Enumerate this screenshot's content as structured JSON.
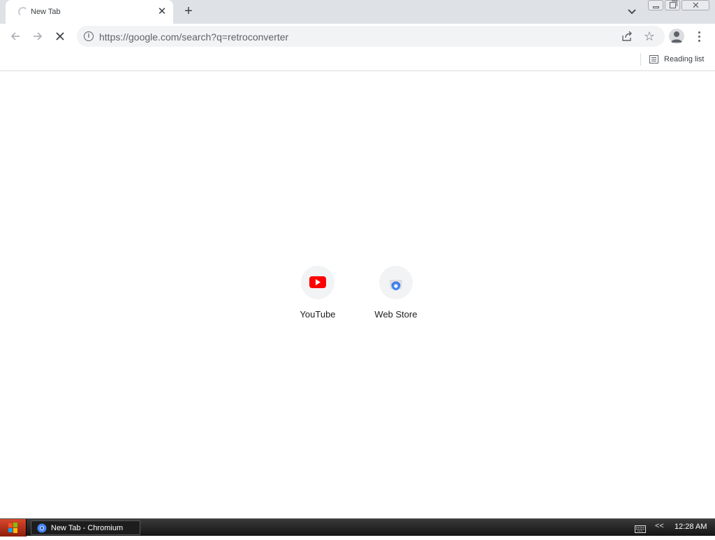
{
  "tab": {
    "title": "New Tab",
    "close_symbol": "✕",
    "new_tab_symbol": "+"
  },
  "omnibox": {
    "url": "https://google.com/search?q=retroconverter"
  },
  "bookmarks_bar": {
    "reading_list_label": "Reading list"
  },
  "shortcuts": [
    {
      "label": "YouTube",
      "icon": "youtube-icon"
    },
    {
      "label": "Web Store",
      "icon": "web-store-icon"
    }
  ],
  "taskbar": {
    "window_title": "New Tab - Chromium",
    "clock": "12:28 AM",
    "tray_expand_symbol": "<<"
  },
  "colors": {
    "tab_strip": "#dee1e6",
    "omnibox_bg": "#f1f3f4",
    "youtube_red": "#ff0000",
    "webstore_blue": "#4285f4"
  }
}
